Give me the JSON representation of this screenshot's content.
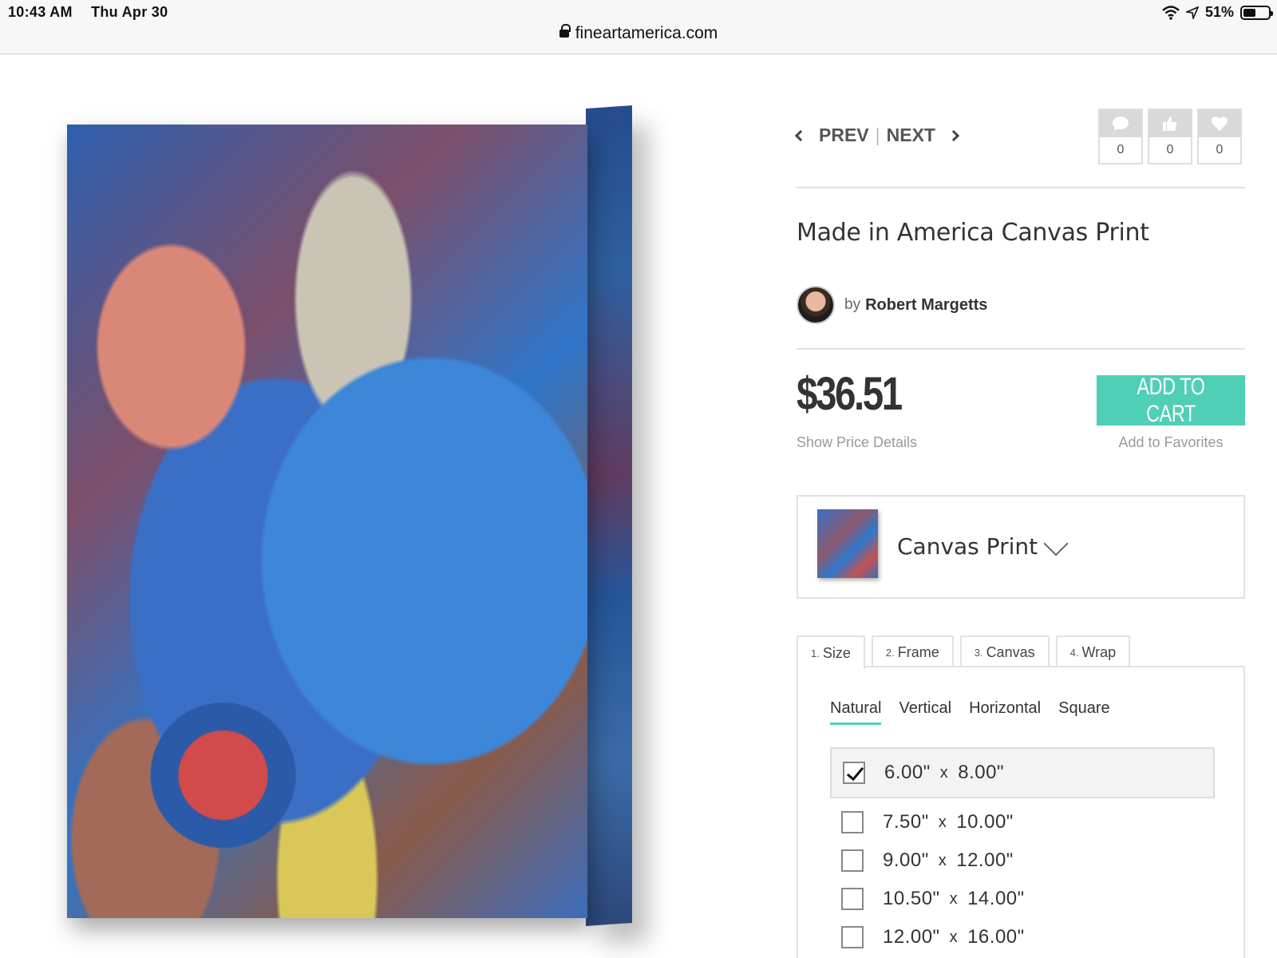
{
  "status_bar": {
    "time": "10:43 AM",
    "date": "Thu Apr 30",
    "battery": "51%",
    "battery_level": 0.51,
    "icons": [
      "wifi-icon",
      "location-arrow-icon",
      "battery-icon"
    ]
  },
  "browser": {
    "url": "fineartamerica.com"
  },
  "nav": {
    "prev_label": "PREV",
    "separator": "|",
    "next_label": "NEXT"
  },
  "social": {
    "comments": "0",
    "likes": "0",
    "favorites": "0"
  },
  "product": {
    "title": "Made in America Canvas Print",
    "artist_prefix": "by",
    "artist_name": "Robert Margetts",
    "price": "$36.51",
    "price_details_link": "Show Price Details",
    "add_to_cart": "ADD TO CART",
    "add_to_favorites": "Add to Favorites",
    "product_type": "Canvas Print"
  },
  "tabs": [
    {
      "num": "1.",
      "label": "Size"
    },
    {
      "num": "2.",
      "label": "Frame"
    },
    {
      "num": "3.",
      "label": "Canvas"
    },
    {
      "num": "4.",
      "label": "Wrap"
    }
  ],
  "orientation": {
    "options": [
      "Natural",
      "Vertical",
      "Horizontal",
      "Square"
    ],
    "selected": "Natural"
  },
  "sizes": [
    {
      "w": "6.00\"",
      "x": "x",
      "h": "8.00\"",
      "checked": true
    },
    {
      "w": "7.50\"",
      "x": "x",
      "h": "10.00\"",
      "checked": false
    },
    {
      "w": "9.00\"",
      "x": "x",
      "h": "12.00\"",
      "checked": false
    },
    {
      "w": "10.50\"",
      "x": "x",
      "h": "14.00\"",
      "checked": false
    },
    {
      "w": "12.00\"",
      "x": "x",
      "h": "16.00\"",
      "checked": false
    }
  ],
  "colors": {
    "accent": "#4fcfb5"
  }
}
